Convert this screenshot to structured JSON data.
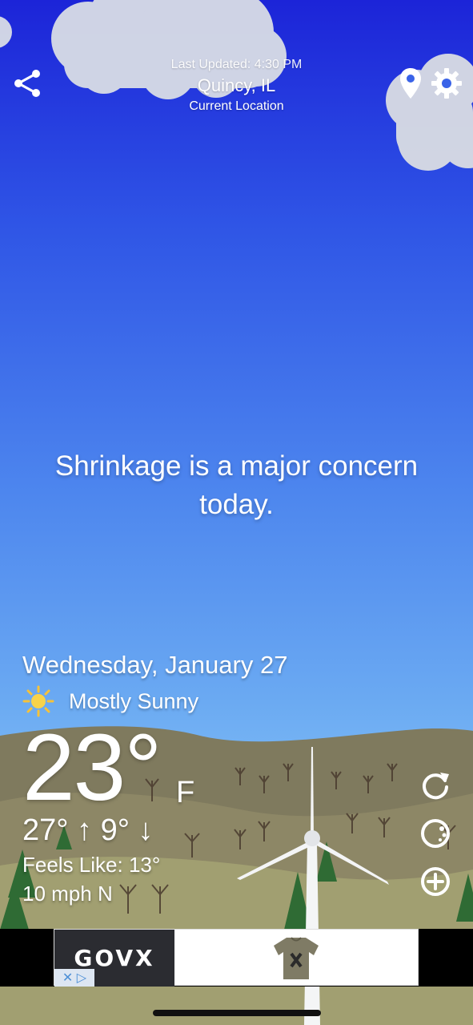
{
  "header": {
    "last_updated": "Last Updated: 4:30 PM",
    "city": "Quincy, IL",
    "location_label": "Current Location"
  },
  "toolbar": {
    "share_icon": "share-icon",
    "location_icon": "map-pin-icon",
    "settings_icon": "gear-icon"
  },
  "message": "Shrinkage is a major concern today.",
  "weather": {
    "date": "Wednesday, January 27",
    "condition": "Mostly Sunny",
    "condition_icon": "sun-icon",
    "temperature": "23°",
    "unit": "F",
    "hi_lo": "27° ↑  9° ↓",
    "feels_like": "Feels Like: 13°",
    "wind": "10 mph N"
  },
  "side_actions": {
    "refresh_icon": "refresh-icon",
    "radar_icon": "radar-icon",
    "add_icon": "add-circle-icon"
  },
  "ad": {
    "brand": "GOVX",
    "close_glyphs": "✕ ▷"
  },
  "colors": {
    "sky_top": "#1c24d8",
    "sky_bottom": "#82c0f6",
    "hills": "#8c8463",
    "ground": "#9f9d6f",
    "trees": "#2f6b34"
  }
}
